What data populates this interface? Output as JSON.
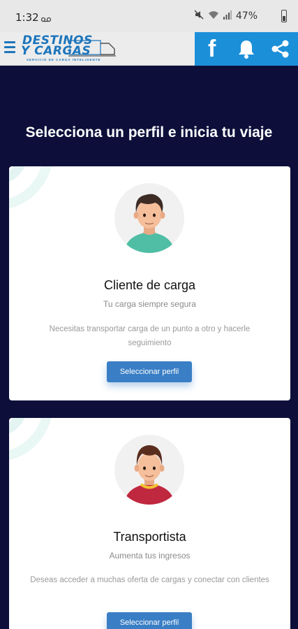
{
  "status_bar": {
    "time": "1:32",
    "battery_percent": "47%",
    "icons": [
      "voicemail-icon",
      "mute-icon",
      "wifi-icon",
      "signal-icon",
      "battery-icon"
    ]
  },
  "header": {
    "logo_line1": "DESTINOS",
    "logo_line2": "Y CARGAS",
    "logo_tagline": "SERVICIO DE CARGA INTELIGENTE",
    "icons": [
      "menu-icon",
      "facebook-icon",
      "bell-icon",
      "share-icon"
    ],
    "accent_color": "#1c8fd9"
  },
  "page": {
    "title": "Selecciona un perfil e inicia tu viaje",
    "background_color": "#0d0f3a"
  },
  "profiles": [
    {
      "title": "Cliente de carga",
      "subtitle": "Tu carga siempre segura",
      "description": "Necesitas transportar carga de un punto a otro y hacerle seguimiento",
      "button_label": "Seleccionar perfil",
      "avatar_icon": "man-avatar-icon"
    },
    {
      "title": "Transportista",
      "subtitle": "Aumenta tus ingresos",
      "description": "Deseas acceder a muchas oferta de cargas y conectar con clientes",
      "button_label": "Seleccionar perfil",
      "avatar_icon": "boy-avatar-icon"
    }
  ]
}
